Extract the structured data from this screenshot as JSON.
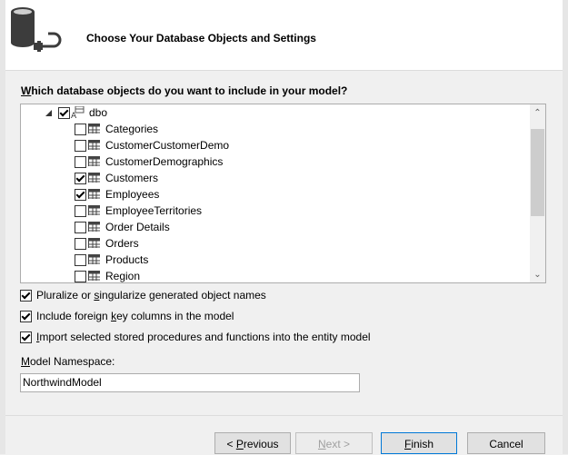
{
  "header": {
    "title": "Choose Your Database Objects and Settings"
  },
  "question": {
    "prefix": "W",
    "rest": "hich database objects do you want to include in your model?"
  },
  "tree": {
    "root": {
      "label": "dbo",
      "checked": true
    },
    "items": [
      {
        "label": "Categories",
        "checked": false
      },
      {
        "label": "CustomerCustomerDemo",
        "checked": false
      },
      {
        "label": "CustomerDemographics",
        "checked": false
      },
      {
        "label": "Customers",
        "checked": true
      },
      {
        "label": "Employees",
        "checked": true
      },
      {
        "label": "EmployeeTerritories",
        "checked": false
      },
      {
        "label": "Order Details",
        "checked": false
      },
      {
        "label": "Orders",
        "checked": false
      },
      {
        "label": "Products",
        "checked": false
      },
      {
        "label": "Region",
        "checked": false
      }
    ]
  },
  "options": {
    "pluralize": {
      "before": "Pluralize or ",
      "accel": "s",
      "after": "ingularize generated object names",
      "checked": true
    },
    "foreign_keys": {
      "before": "Include foreign ",
      "accel": "k",
      "after": "ey columns in the model",
      "checked": true
    },
    "import_sprocs": {
      "before": "",
      "accel": "I",
      "after": "mport selected stored procedures and functions into the entity model",
      "checked": true
    }
  },
  "namespace": {
    "label_accel": "M",
    "label_rest": "odel Namespace:",
    "value": "NorthwindModel"
  },
  "buttons": {
    "previous": {
      "before": "< ",
      "accel": "P",
      "after": "revious"
    },
    "next": {
      "before": "",
      "accel": "N",
      "after": "ext >"
    },
    "finish": {
      "before": "",
      "accel": "F",
      "after": "inish"
    },
    "cancel": {
      "label": "Cancel"
    }
  }
}
